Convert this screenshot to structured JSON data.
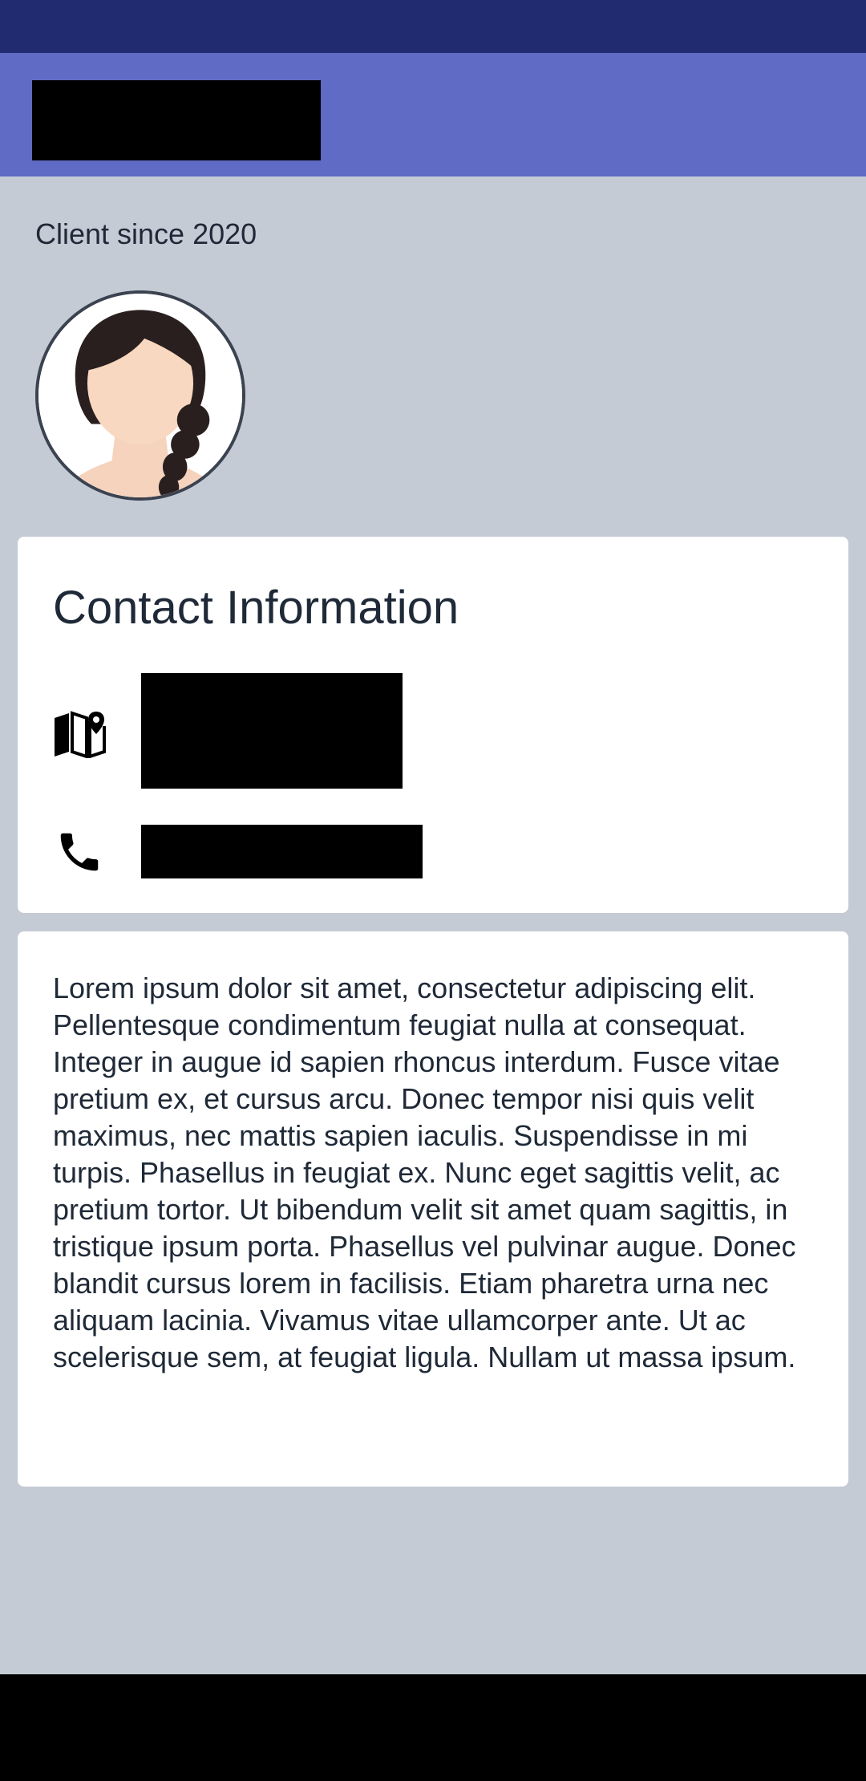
{
  "status_bar": {},
  "app_bar": {
    "title": ""
  },
  "profile": {
    "client_since": "Client since 2020",
    "avatar_icon": "avatar-woman-icon"
  },
  "contact": {
    "title": "Contact Information",
    "address": "",
    "address_icon": "map-icon",
    "phone": "",
    "phone_icon": "phone-icon"
  },
  "about": {
    "text": "Lorem ipsum dolor sit amet, consectetur adipiscing elit. Pellentesque condimentum feugiat nulla at consequat. Integer in augue id sapien rhoncus interdum. Fusce vitae pretium ex, et cursus arcu. Donec tempor nisi quis velit maximus, nec mattis sapien iaculis. Suspendisse in mi turpis. Phasellus in feugiat ex. Nunc eget sagittis velit, ac pretium tortor. Ut bibendum velit sit amet quam sagittis, in tristique ipsum porta. Phasellus vel pulvinar augue. Donec blandit cursus lorem in facilisis. Etiam pharetra urna nec aliquam lacinia. Vivamus vitae ullamcorper ante. Ut ac scelerisque sem, at feugiat ligula. Nullam ut massa ipsum."
  },
  "colors": {
    "status_bar": "#202b70",
    "app_bar": "#5f6bc4",
    "background": "#c5cbd5",
    "card": "#ffffff",
    "text": "#1f2937"
  }
}
